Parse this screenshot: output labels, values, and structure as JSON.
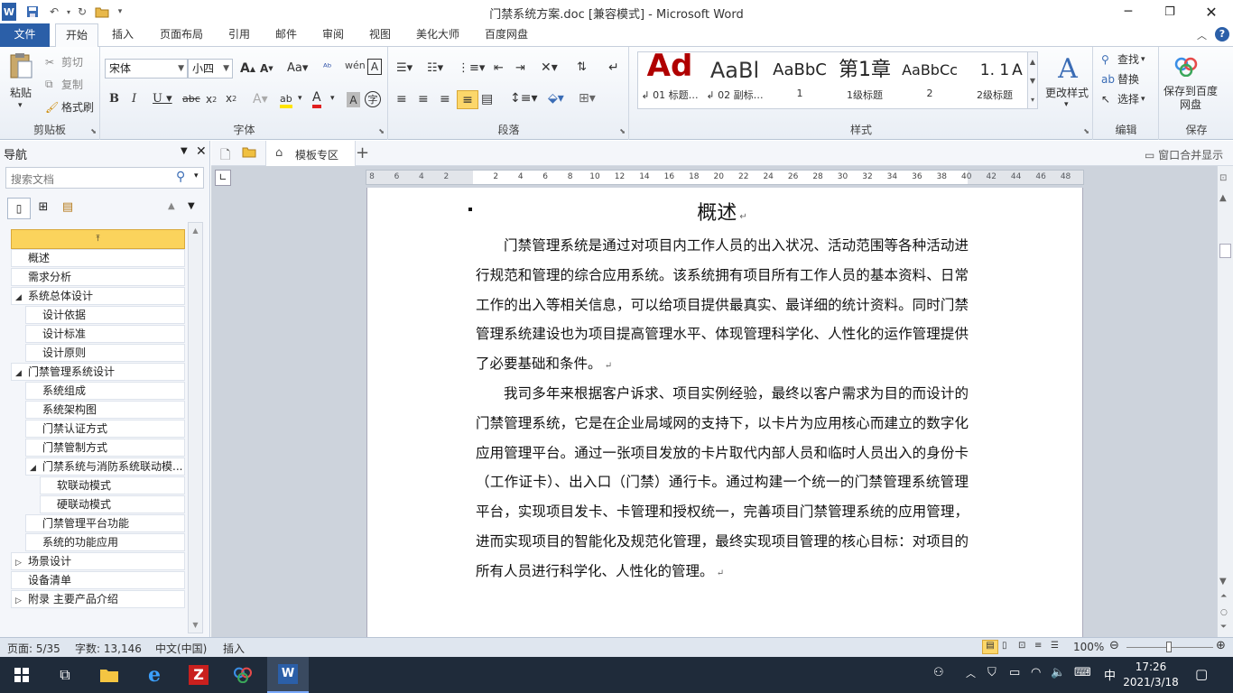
{
  "titlebar": {
    "title": "门禁系统方案.doc [兼容模式] - Microsoft Word"
  },
  "tabs": [
    "文件",
    "开始",
    "插入",
    "页面布局",
    "引用",
    "邮件",
    "审阅",
    "视图",
    "美化大师",
    "百度网盘"
  ],
  "ribbon": {
    "clipboard": {
      "paste": "粘贴",
      "cut": "剪切",
      "copy": "复制",
      "format_painter": "格式刷",
      "label": "剪贴板"
    },
    "font": {
      "font_name": "宋体",
      "font_size": "小四",
      "label": "字体"
    },
    "paragraph": {
      "label": "段落"
    },
    "styles": {
      "items": [
        {
          "sample": "Ad",
          "name": "↲ 01 标题…"
        },
        {
          "sample": "AaBl",
          "name": "↲ 02 副标…"
        },
        {
          "sample": "AaBbC",
          "name": "1"
        },
        {
          "sample": "第1章",
          "name": "1级标题"
        },
        {
          "sample": "AaBbCc",
          "name": "2"
        },
        {
          "sample": "1. 1",
          "name": "2级标题"
        },
        {
          "sample": "A",
          "name": ""
        }
      ],
      "change_styles": "更改样式",
      "label": "样式"
    },
    "editing": {
      "find": "查找",
      "replace": "替换",
      "select": "选择",
      "label": "编辑"
    },
    "save": {
      "save_baidu": "保存到百度网盘",
      "label": "保存"
    }
  },
  "nav": {
    "title": "导航",
    "search_placeholder": "搜索文档",
    "items": [
      {
        "label": "概述",
        "level": 1,
        "expander": ""
      },
      {
        "label": "需求分析",
        "level": 1,
        "expander": ""
      },
      {
        "label": "系统总体设计",
        "level": 1,
        "expander": "expanded"
      },
      {
        "label": "设计依据",
        "level": 2,
        "expander": ""
      },
      {
        "label": "设计标准",
        "level": 2,
        "expander": ""
      },
      {
        "label": "设计原则",
        "level": 2,
        "expander": ""
      },
      {
        "label": "门禁管理系统设计",
        "level": 1,
        "expander": "expanded"
      },
      {
        "label": "系统组成",
        "level": 2,
        "expander": ""
      },
      {
        "label": "系统架构图",
        "level": 2,
        "expander": ""
      },
      {
        "label": "门禁认证方式",
        "level": 2,
        "expander": ""
      },
      {
        "label": "门禁管制方式",
        "level": 2,
        "expander": ""
      },
      {
        "label": "门禁系统与消防系统联动模...",
        "level": 2,
        "expander": "expanded"
      },
      {
        "label": "软联动模式",
        "level": 3,
        "expander": ""
      },
      {
        "label": "硬联动模式",
        "level": 3,
        "expander": ""
      },
      {
        "label": "门禁管理平台功能",
        "level": 2,
        "expander": ""
      },
      {
        "label": "系统的功能应用",
        "level": 2,
        "expander": ""
      },
      {
        "label": "场景设计",
        "level": 1,
        "expander": "collapsed"
      },
      {
        "label": "设备清单",
        "level": 1,
        "expander": ""
      },
      {
        "label": "附录  主要产品介绍",
        "level": 1,
        "expander": "collapsed"
      }
    ]
  },
  "doctabs": {
    "template_zone": "模板专区",
    "merge_windows": "窗口合并显示"
  },
  "ruler": {
    "ticks": [
      "8",
      "6",
      "4",
      "2",
      "",
      "2",
      "4",
      "6",
      "8",
      "10",
      "12",
      "14",
      "16",
      "18",
      "20",
      "22",
      "24",
      "26",
      "28",
      "30",
      "32",
      "34",
      "36",
      "38",
      "40",
      "42",
      "44",
      "46",
      "48"
    ]
  },
  "document": {
    "heading": "概述",
    "paragraphs": [
      "门禁管理系统是通过对项目内工作人员的出入状况、活动范围等各种活动进行规范和管理的综合应用系统。该系统拥有项目所有工作人员的基本资料、日常工作的出入等相关信息，可以给项目提供最真实、最详细的统计资料。同时门禁管理系统建设也为项目提高管理水平、体现管理科学化、人性化的运作管理提供了必要基础和条件。",
      "我司多年来根据客户诉求、项目实例经验，最终以客户需求为目的而设计的门禁管理系统，它是在企业局域网的支持下，以卡片为应用核心而建立的数字化应用管理平台。通过一张项目发放的卡片取代内部人员和临时人员出入的身份卡（工作证卡）、出入口（门禁）通行卡。通过构建一个统一的门禁管理系统管理平台，实现项目发卡、卡管理和授权统一，完善项目门禁管理系统的应用管理，进而实现项目的智能化及规范化管理，最终实现项目管理的核心目标：对项目的所有人员进行科学化、人性化的管理。"
    ]
  },
  "status": {
    "page": "页面: 5/35",
    "words": "字数: 13,146",
    "lang": "中文(中国)",
    "mode": "插入",
    "zoom": "100%"
  },
  "taskbar": {
    "ime": "中",
    "time": "17:26",
    "date": "2021/3/18"
  },
  "colors": {
    "accent": "#2b5fa8",
    "nav_selected": "#fbd35c",
    "taskbar": "#1f2b3a"
  }
}
